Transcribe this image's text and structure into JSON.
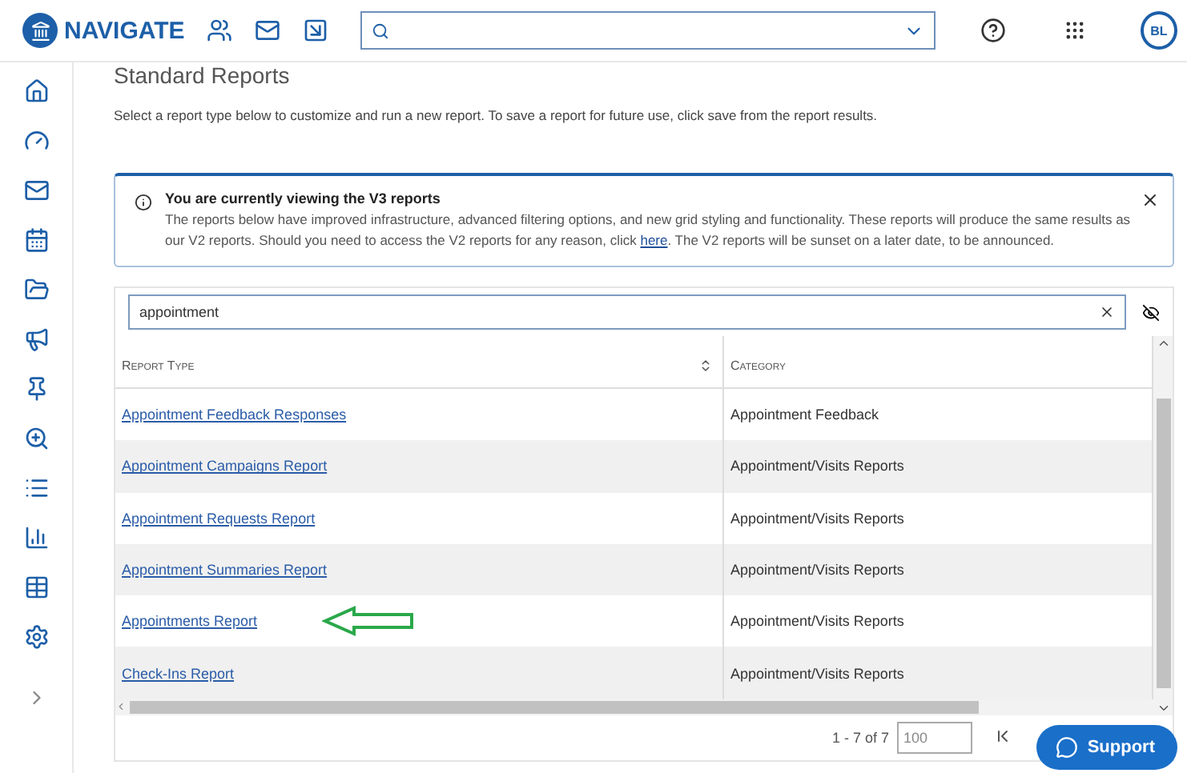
{
  "topbar": {
    "brand": "NAVIGATE",
    "avatar": "BL"
  },
  "page": {
    "title": "Standard Reports",
    "description": "Select a report type below to customize and run a new report. To save a report for future use, click save from the report results."
  },
  "alert": {
    "title": "You are currently viewing the V3 reports",
    "text_before": "The reports below have improved infrastructure, advanced filtering options, and new grid styling and functionality. These reports will produce the same results as our V2 reports. Should you need to access the V2 reports for any reason, click ",
    "link": "here",
    "text_after": ". The V2 reports will be sunset on a later date, to be announced."
  },
  "search": {
    "value": "appointment"
  },
  "table": {
    "columns": [
      "Report Type",
      "Category"
    ],
    "rows": [
      {
        "report_type": "Appointment Feedback Responses",
        "category": "Appointment Feedback"
      },
      {
        "report_type": "Appointment Campaigns Report",
        "category": "Appointment/Visits Reports"
      },
      {
        "report_type": "Appointment Requests Report",
        "category": "Appointment/Visits Reports"
      },
      {
        "report_type": "Appointment Summaries Report",
        "category": "Appointment/Visits Reports"
      },
      {
        "report_type": "Appointments Report",
        "category": "Appointment/Visits Reports",
        "annotated": true
      },
      {
        "report_type": "Check-Ins Report",
        "category": "Appointment/Visits Reports"
      }
    ]
  },
  "pagination": {
    "range": "1 - 7 of 7",
    "page_size": "100"
  },
  "support": {
    "label": "Support"
  }
}
